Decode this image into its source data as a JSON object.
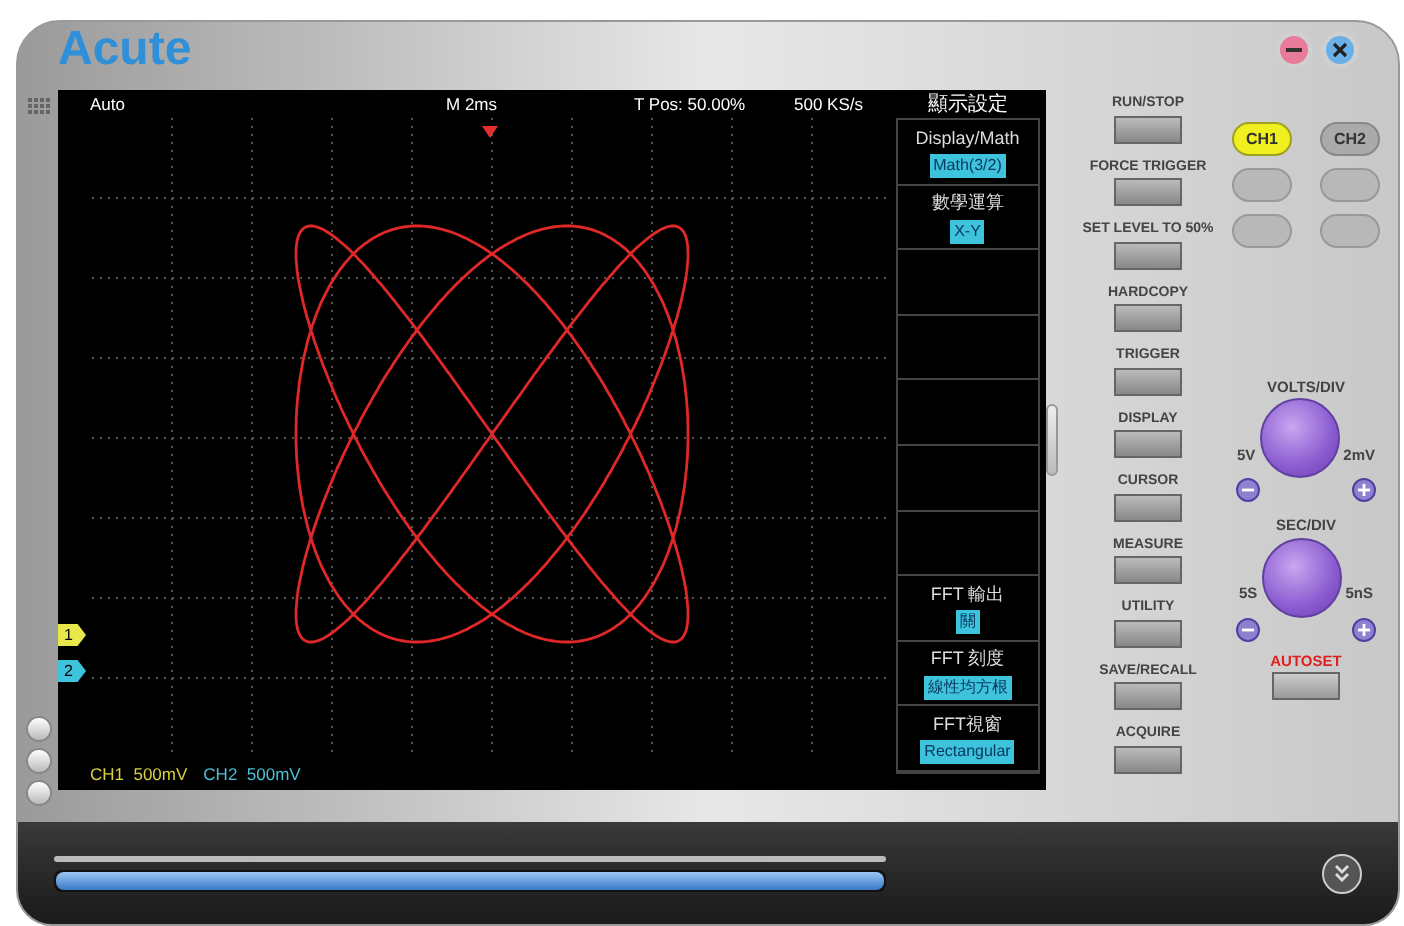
{
  "window": {
    "logo": "Acute"
  },
  "screen": {
    "status": {
      "mode": "Auto",
      "timebase": "M 2ms",
      "trigger_position": "T Pos: 50.00%",
      "sample_rate": "500 KS/s"
    },
    "channel_markers": [
      {
        "label": "1",
        "color": "#e8e84a"
      },
      {
        "label": "2",
        "color": "#3ec3dc"
      }
    ],
    "readouts": [
      {
        "text": "CH1  500mV",
        "color": "#d8d040"
      },
      {
        "text": "CH2  500mV",
        "color": "#4ec0d8"
      }
    ]
  },
  "menu": {
    "title": "顯示設定",
    "items": [
      {
        "kind": "option",
        "label": "Display/Math",
        "value": "Math(3/2)"
      },
      {
        "kind": "option",
        "label": "數學運算",
        "value": "X-Y"
      },
      {
        "kind": "empty"
      },
      {
        "kind": "empty"
      },
      {
        "kind": "empty"
      },
      {
        "kind": "empty"
      },
      {
        "kind": "empty"
      },
      {
        "kind": "option",
        "label": "FFT 輸出",
        "value": "關"
      },
      {
        "kind": "option",
        "label": "FFT 刻度",
        "value": "線性均方根"
      },
      {
        "kind": "option",
        "label": "FFT視窗",
        "value": "Rectangular"
      }
    ]
  },
  "panel_buttons": [
    {
      "label": "RUN/STOP"
    },
    {
      "label": "FORCE TRIGGER"
    },
    {
      "label": "SET LEVEL TO 50%"
    },
    {
      "label": "HARDCOPY"
    },
    {
      "label": "TRIGGER"
    },
    {
      "label": "DISPLAY"
    },
    {
      "label": "CURSOR"
    },
    {
      "label": "MEASURE"
    },
    {
      "label": "UTILITY"
    },
    {
      "label": "SAVE/RECALL"
    },
    {
      "label": "ACQUIRE"
    }
  ],
  "channel_buttons": [
    {
      "label": "CH1",
      "selected": true
    },
    {
      "label": "CH2",
      "selected": false
    }
  ],
  "knobs": [
    {
      "title": "VOLTS/DIV",
      "min_label": "5V",
      "max_label": "2mV"
    },
    {
      "title": "SEC/DIV",
      "min_label": "5S",
      "max_label": "5nS"
    }
  ],
  "autoset": {
    "label": "AUTOSET"
  },
  "progress": {
    "level": 1
  }
}
